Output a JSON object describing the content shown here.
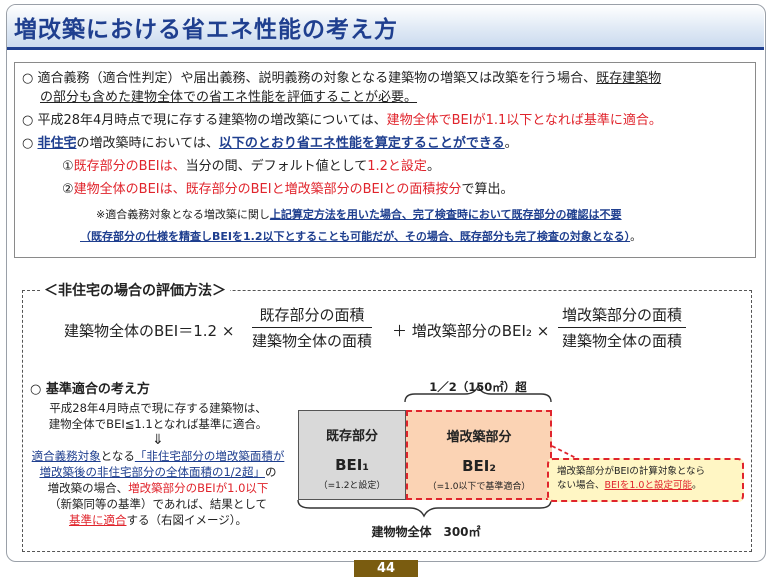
{
  "title": "増改築における省エネ性能の考え方",
  "intro": {
    "l1_prefix": "○ 適合義務（適合性判定）や届出義務、説明義務の対象となる建築物の増築又は改築を行う場合、",
    "l1_underlined": "既存建築物",
    "l2": "の部分も含めた建物全体での省エネ性能を評価することが必要。",
    "l3_prefix": "○ 平成28年4月時点で現に存する建築物の増改築については、",
    "l3_red": "建物全体でBEIが1.1以下となれば基準に適合。",
    "l4_a": "○ ",
    "l4_b": "非住宅",
    "l4_c": "の増改築時においては、",
    "l4_d": "以下のとおり省エネ性能を算定することができる",
    "l4_e": "。",
    "l5_a": "①",
    "l5_b": "既存部分のBEIは、",
    "l5_c": "当分の間、デフォルト値として",
    "l5_d": "1.2と設定",
    "l5_e": "。",
    "l6_a": "②",
    "l6_b": "建物全体のBEIは、既存部分のBEIと増改築部分のBEIとの面積按分",
    "l6_c": "で算出。",
    "note1_a": "※適合義務対象となる増改築に関し",
    "note1_b": "上記算定方法を用いた場合、完了検査時において既存部分の確認は不要",
    "note2": "（既存部分の仕様を精査しBEIを1.2以下とすることも可能だが、その場合、既存部分も完了検査の対象となる）",
    "note2_end": "。"
  },
  "eval": {
    "heading": "＜非住宅の場合の評価方法＞",
    "lhs": "建築物全体のBEI＝1.2 ×",
    "frac1_num": "既存部分の面積",
    "frac1_den": "建築物全体の面積",
    "plus": "＋ 増改築部分のBEI₂ ×",
    "frac2_num": "増改築部分の面積",
    "frac2_den": "建築物全体の面積"
  },
  "criteria": {
    "heading": "○ 基準適合の考え方",
    "t1": "平成28年4月時点で現に存する建築物は、",
    "t2": "建物全体でBEI≦1.1となれば基準に適合。",
    "arrow": "⇓",
    "t3_a": "適合義務対象",
    "t3_b": "となる",
    "t3_c": "「非住宅部分の増改築面積が",
    "t4": "増改築後の非住宅部分の全体面積の1/2超」",
    "t4_b": "の",
    "t5_a": "増改築の場合、",
    "t5_b": "増改築部分のBEIが1.0以下",
    "t6": "（新築同等の基準）であれば、結果として",
    "t7_a": "基準に適合",
    "t7_b": "する（右図イメージ）。"
  },
  "diagram": {
    "top_label": "1／2（150㎡）超",
    "existing_name": "既存部分",
    "existing_bei": "BEI₁",
    "existing_sub": "（=1.2と設定）",
    "new_name": "増改築部分",
    "new_bei": "BEI₂",
    "new_sub": "（=1.0以下で基準適合）",
    "bottom_label": "建物物全体　300㎡",
    "callout_a": "増改築部分がBEIの計算対象となら",
    "callout_b": "ない場合、",
    "callout_c": "BEIを1.0と設定可能",
    "callout_d": "。",
    "colors": {
      "existing": "#d9d9d9",
      "new": "#fbd3b4",
      "red": "#e0242c",
      "navy": "#1f3f8f"
    }
  },
  "page_number": "44"
}
